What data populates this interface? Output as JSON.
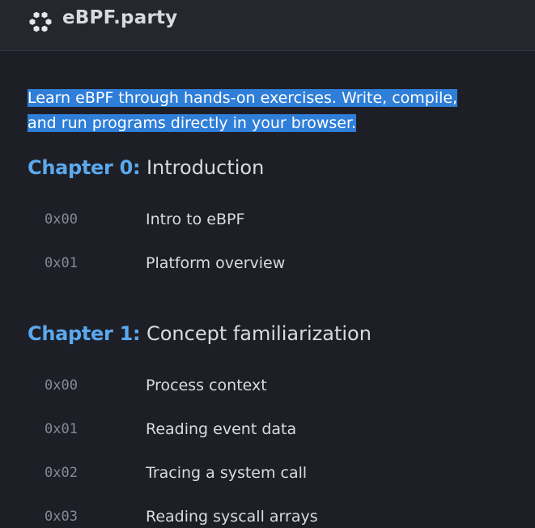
{
  "header": {
    "title": "eBPF.party",
    "logo_icon": "hexagon-cluster-icon"
  },
  "intro": {
    "line1": "Learn eBPF through hands-on exercises. Write, compile,",
    "line2": "and run programs directly in your browser."
  },
  "chapters": [
    {
      "number": "Chapter 0:",
      "title": "Introduction",
      "lessons": [
        {
          "id": "0x00",
          "title": "Intro to eBPF"
        },
        {
          "id": "0x01",
          "title": "Platform overview"
        }
      ]
    },
    {
      "number": "Chapter 1:",
      "title": "Concept familiarization",
      "lessons": [
        {
          "id": "0x00",
          "title": "Process context"
        },
        {
          "id": "0x01",
          "title": "Reading event data"
        },
        {
          "id": "0x02",
          "title": "Tracing a system call"
        },
        {
          "id": "0x03",
          "title": "Reading syscall arrays"
        }
      ]
    }
  ],
  "colors": {
    "background": "#1e1f26",
    "header": "#25272f",
    "accent": "#5aa9f0",
    "selection": "#2f7ed8"
  }
}
